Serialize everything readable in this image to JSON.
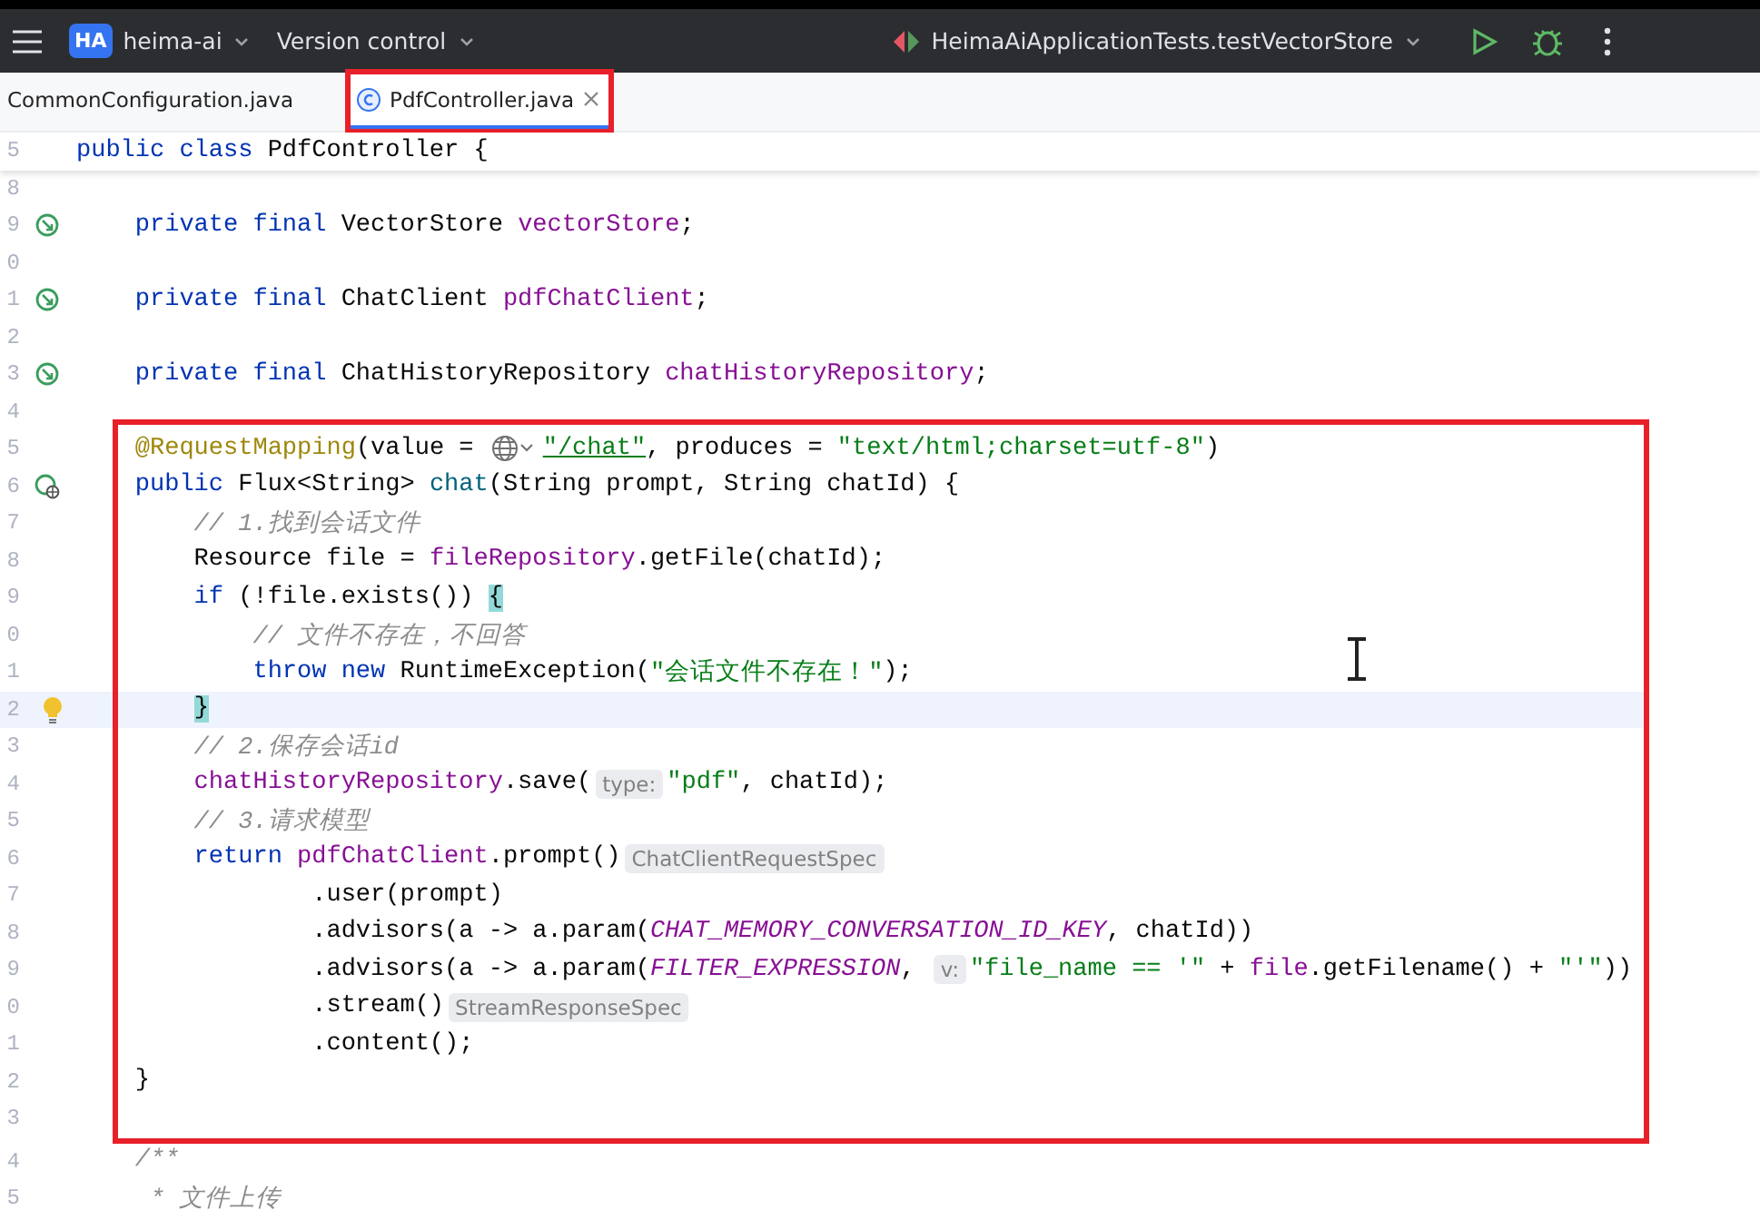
{
  "toolbar": {
    "project_badge": "HA",
    "project": "heima-ai",
    "vcs": "Version control",
    "run_config": "HeimaAiApplicationTests.testVectorStore"
  },
  "tabs": [
    {
      "label": "CommonConfiguration.java",
      "selected": false,
      "marked": false
    },
    {
      "label": "PdfController.java",
      "selected": true,
      "marked": true
    }
  ],
  "editor": {
    "sticky": {
      "number": "5",
      "tokens": [
        {
          "kind": "keyword",
          "text": "public class"
        },
        {
          "kind": "plain",
          "text": " PdfController {"
        }
      ]
    },
    "lines_before": [
      {
        "number": "8",
        "kind": "plain",
        "current": false
      },
      {
        "number": "9",
        "kind": "bean",
        "current": false,
        "tokens": [
          {
            "kind": "keyword",
            "text": "    private final"
          },
          {
            "kind": "plain",
            "text": " VectorStore "
          },
          {
            "kind": "field",
            "text": "vectorStore"
          },
          {
            "kind": "plain",
            "text": ";"
          }
        ]
      },
      {
        "number": "0",
        "kind": "plain",
        "current": false
      },
      {
        "number": "1",
        "kind": "bean",
        "current": false,
        "tokens": [
          {
            "kind": "keyword",
            "text": "    private final"
          },
          {
            "kind": "plain",
            "text": " ChatClient "
          },
          {
            "kind": "field",
            "text": "pdfChatClient"
          },
          {
            "kind": "plain",
            "text": ";"
          }
        ]
      },
      {
        "number": "2",
        "kind": "plain",
        "current": false
      },
      {
        "number": "3",
        "kind": "bean",
        "current": false,
        "tokens": [
          {
            "kind": "keyword",
            "text": "    private final"
          },
          {
            "kind": "plain",
            "text": " ChatHistoryRepository "
          },
          {
            "kind": "field",
            "text": "chatHistoryRepository"
          },
          {
            "kind": "plain",
            "text": ";"
          }
        ]
      },
      {
        "number": "4",
        "kind": "plain",
        "current": false
      }
    ],
    "highlight_box": {
      "lines": [
        {
          "number": "5",
          "kind": "plain",
          "current": false,
          "tokens": [
            {
              "kind": "annotation",
              "text": "    @RequestMapping"
            },
            {
              "kind": "plain",
              "text": "(value = "
            },
            {
              "kind": "globe"
            },
            {
              "kind": "url",
              "text": "\"/chat\""
            },
            {
              "kind": "plain",
              "text": ", produces = "
            },
            {
              "kind": "string",
              "text": "\"text/html;charset=utf-8\""
            },
            {
              "kind": "plain",
              "text": ")"
            }
          ]
        },
        {
          "number": "6",
          "kind": "web",
          "current": false,
          "tokens": [
            {
              "kind": "keyword",
              "text": "    public"
            },
            {
              "kind": "plain",
              "text": " Flux<String> "
            },
            {
              "kind": "method",
              "text": "chat"
            },
            {
              "kind": "plain",
              "text": "(String prompt, String chatId) {"
            }
          ]
        },
        {
          "number": "7",
          "kind": "plain",
          "current": false,
          "tokens": [
            {
              "kind": "comment",
              "text": "        // 1.找到会话文件"
            }
          ]
        },
        {
          "number": "8",
          "kind": "plain",
          "current": false,
          "tokens": [
            {
              "kind": "plain",
              "text": "        Resource file = "
            },
            {
              "kind": "field",
              "text": "fileRepository"
            },
            {
              "kind": "plain",
              "text": ".getFile(chatId);"
            }
          ]
        },
        {
          "number": "9",
          "kind": "plain",
          "current": false,
          "tokens": [
            {
              "kind": "keyword",
              "text": "        if"
            },
            {
              "kind": "plain",
              "text": " (!file.exists()) "
            },
            {
              "kind": "brace",
              "text": "{"
            }
          ]
        },
        {
          "number": "0",
          "kind": "plain",
          "current": false,
          "tokens": [
            {
              "kind": "comment",
              "text": "            // 文件不存在，不回答"
            }
          ]
        },
        {
          "number": "1",
          "kind": "plain",
          "current": false,
          "tokens": [
            {
              "kind": "keyword",
              "text": "            throw new"
            },
            {
              "kind": "plain",
              "text": " RuntimeException("
            },
            {
              "kind": "string",
              "text": "\"会话文件不存在！\""
            },
            {
              "kind": "plain",
              "text": ");"
            }
          ]
        },
        {
          "number": "2",
          "kind": "bulb",
          "current": true,
          "tokens": [
            {
              "kind": "brace",
              "text": "        }"
            }
          ]
        },
        {
          "number": "3",
          "kind": "plain",
          "current": false,
          "tokens": [
            {
              "kind": "comment",
              "text": "        // 2.保存会话id"
            }
          ]
        },
        {
          "number": "4",
          "kind": "plain",
          "current": false,
          "tokens": [
            {
              "kind": "field",
              "text": "        chatHistoryRepository"
            },
            {
              "kind": "plain",
              "text": ".save("
            },
            {
              "kind": "hint",
              "text": "type:"
            },
            {
              "kind": "string",
              "text": "\"pdf\""
            },
            {
              "kind": "plain",
              "text": ", chatId);"
            }
          ]
        },
        {
          "number": "5",
          "kind": "plain",
          "current": false,
          "tokens": [
            {
              "kind": "comment",
              "text": "        // 3.请求模型"
            }
          ]
        },
        {
          "number": "6",
          "kind": "plain",
          "current": false,
          "tokens": [
            {
              "kind": "keyword",
              "text": "        return "
            },
            {
              "kind": "field",
              "text": "pdfChatClient"
            },
            {
              "kind": "plain",
              "text": ".prompt()"
            },
            {
              "kind": "hint",
              "text": "ChatClientRequestSpec"
            }
          ]
        },
        {
          "number": "7",
          "kind": "plain",
          "current": false,
          "tokens": [
            {
              "kind": "plain",
              "text": "                .user(prompt)"
            }
          ]
        },
        {
          "number": "8",
          "kind": "plain",
          "current": false,
          "tokens": [
            {
              "kind": "plain",
              "text": "                .advisors(a -> a.param("
            },
            {
              "kind": "constant",
              "text": "CHAT_MEMORY_CONVERSATION_ID_KEY"
            },
            {
              "kind": "plain",
              "text": ", chatId))"
            }
          ]
        },
        {
          "number": "9",
          "kind": "plain",
          "current": false,
          "tokens": [
            {
              "kind": "plain",
              "text": "                .advisors(a -> a.param("
            },
            {
              "kind": "constant",
              "text": "FILTER_EXPRESSION"
            },
            {
              "kind": "plain",
              "text": ", "
            },
            {
              "kind": "hint",
              "text": "v:"
            },
            {
              "kind": "string",
              "text": "\"file_name == '\""
            },
            {
              "kind": "plain",
              "text": " + "
            },
            {
              "kind": "field",
              "text": "file"
            },
            {
              "kind": "plain",
              "text": ".getFilename() + "
            },
            {
              "kind": "string",
              "text": "\"'\""
            },
            {
              "kind": "plain",
              "text": "))"
            }
          ]
        },
        {
          "number": "0",
          "kind": "plain",
          "current": false,
          "tokens": [
            {
              "kind": "plain",
              "text": "                .stream()"
            },
            {
              "kind": "hint",
              "text": "StreamResponseSpec"
            }
          ]
        },
        {
          "number": "1",
          "kind": "plain",
          "current": false,
          "tokens": [
            {
              "kind": "plain",
              "text": "                .content();"
            }
          ]
        },
        {
          "number": "2",
          "kind": "plain",
          "current": false,
          "tokens": [
            {
              "kind": "plain",
              "text": "    }"
            }
          ]
        },
        {
          "number": "3",
          "kind": "plain",
          "current": false
        }
      ]
    },
    "lines_after": [
      {
        "number": "4",
        "current": false,
        "tokens": [
          {
            "kind": "comment",
            "text": "    /**"
          }
        ]
      },
      {
        "number": "5",
        "current": false,
        "tokens": [
          {
            "kind": "comment",
            "text": "     * 文件上传"
          }
        ]
      }
    ]
  }
}
